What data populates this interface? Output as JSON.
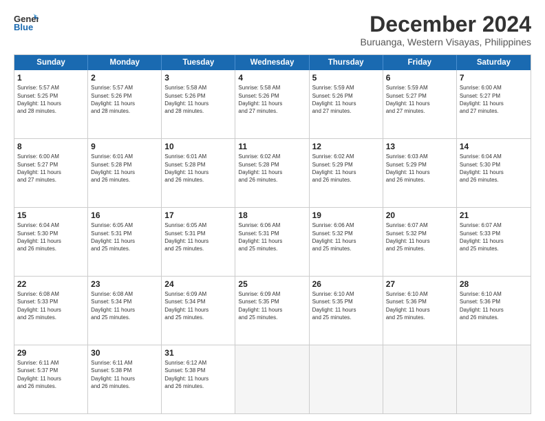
{
  "logo": {
    "line1": "General",
    "line2": "Blue"
  },
  "title": "December 2024",
  "subtitle": "Buruanga, Western Visayas, Philippines",
  "days": [
    "Sunday",
    "Monday",
    "Tuesday",
    "Wednesday",
    "Thursday",
    "Friday",
    "Saturday"
  ],
  "rows": [
    [
      {
        "day": "1",
        "info": "Sunrise: 5:57 AM\nSunset: 5:25 PM\nDaylight: 11 hours\nand 28 minutes."
      },
      {
        "day": "2",
        "info": "Sunrise: 5:57 AM\nSunset: 5:26 PM\nDaylight: 11 hours\nand 28 minutes."
      },
      {
        "day": "3",
        "info": "Sunrise: 5:58 AM\nSunset: 5:26 PM\nDaylight: 11 hours\nand 28 minutes."
      },
      {
        "day": "4",
        "info": "Sunrise: 5:58 AM\nSunset: 5:26 PM\nDaylight: 11 hours\nand 27 minutes."
      },
      {
        "day": "5",
        "info": "Sunrise: 5:59 AM\nSunset: 5:26 PM\nDaylight: 11 hours\nand 27 minutes."
      },
      {
        "day": "6",
        "info": "Sunrise: 5:59 AM\nSunset: 5:27 PM\nDaylight: 11 hours\nand 27 minutes."
      },
      {
        "day": "7",
        "info": "Sunrise: 6:00 AM\nSunset: 5:27 PM\nDaylight: 11 hours\nand 27 minutes."
      }
    ],
    [
      {
        "day": "8",
        "info": "Sunrise: 6:00 AM\nSunset: 5:27 PM\nDaylight: 11 hours\nand 27 minutes."
      },
      {
        "day": "9",
        "info": "Sunrise: 6:01 AM\nSunset: 5:28 PM\nDaylight: 11 hours\nand 26 minutes."
      },
      {
        "day": "10",
        "info": "Sunrise: 6:01 AM\nSunset: 5:28 PM\nDaylight: 11 hours\nand 26 minutes."
      },
      {
        "day": "11",
        "info": "Sunrise: 6:02 AM\nSunset: 5:28 PM\nDaylight: 11 hours\nand 26 minutes."
      },
      {
        "day": "12",
        "info": "Sunrise: 6:02 AM\nSunset: 5:29 PM\nDaylight: 11 hours\nand 26 minutes."
      },
      {
        "day": "13",
        "info": "Sunrise: 6:03 AM\nSunset: 5:29 PM\nDaylight: 11 hours\nand 26 minutes."
      },
      {
        "day": "14",
        "info": "Sunrise: 6:04 AM\nSunset: 5:30 PM\nDaylight: 11 hours\nand 26 minutes."
      }
    ],
    [
      {
        "day": "15",
        "info": "Sunrise: 6:04 AM\nSunset: 5:30 PM\nDaylight: 11 hours\nand 26 minutes."
      },
      {
        "day": "16",
        "info": "Sunrise: 6:05 AM\nSunset: 5:31 PM\nDaylight: 11 hours\nand 25 minutes."
      },
      {
        "day": "17",
        "info": "Sunrise: 6:05 AM\nSunset: 5:31 PM\nDaylight: 11 hours\nand 25 minutes."
      },
      {
        "day": "18",
        "info": "Sunrise: 6:06 AM\nSunset: 5:31 PM\nDaylight: 11 hours\nand 25 minutes."
      },
      {
        "day": "19",
        "info": "Sunrise: 6:06 AM\nSunset: 5:32 PM\nDaylight: 11 hours\nand 25 minutes."
      },
      {
        "day": "20",
        "info": "Sunrise: 6:07 AM\nSunset: 5:32 PM\nDaylight: 11 hours\nand 25 minutes."
      },
      {
        "day": "21",
        "info": "Sunrise: 6:07 AM\nSunset: 5:33 PM\nDaylight: 11 hours\nand 25 minutes."
      }
    ],
    [
      {
        "day": "22",
        "info": "Sunrise: 6:08 AM\nSunset: 5:33 PM\nDaylight: 11 hours\nand 25 minutes."
      },
      {
        "day": "23",
        "info": "Sunrise: 6:08 AM\nSunset: 5:34 PM\nDaylight: 11 hours\nand 25 minutes."
      },
      {
        "day": "24",
        "info": "Sunrise: 6:09 AM\nSunset: 5:34 PM\nDaylight: 11 hours\nand 25 minutes."
      },
      {
        "day": "25",
        "info": "Sunrise: 6:09 AM\nSunset: 5:35 PM\nDaylight: 11 hours\nand 25 minutes."
      },
      {
        "day": "26",
        "info": "Sunrise: 6:10 AM\nSunset: 5:35 PM\nDaylight: 11 hours\nand 25 minutes."
      },
      {
        "day": "27",
        "info": "Sunrise: 6:10 AM\nSunset: 5:36 PM\nDaylight: 11 hours\nand 25 minutes."
      },
      {
        "day": "28",
        "info": "Sunrise: 6:10 AM\nSunset: 5:36 PM\nDaylight: 11 hours\nand 26 minutes."
      }
    ],
    [
      {
        "day": "29",
        "info": "Sunrise: 6:11 AM\nSunset: 5:37 PM\nDaylight: 11 hours\nand 26 minutes."
      },
      {
        "day": "30",
        "info": "Sunrise: 6:11 AM\nSunset: 5:38 PM\nDaylight: 11 hours\nand 26 minutes."
      },
      {
        "day": "31",
        "info": "Sunrise: 6:12 AM\nSunset: 5:38 PM\nDaylight: 11 hours\nand 26 minutes."
      },
      {
        "day": "",
        "info": ""
      },
      {
        "day": "",
        "info": ""
      },
      {
        "day": "",
        "info": ""
      },
      {
        "day": "",
        "info": ""
      }
    ]
  ]
}
